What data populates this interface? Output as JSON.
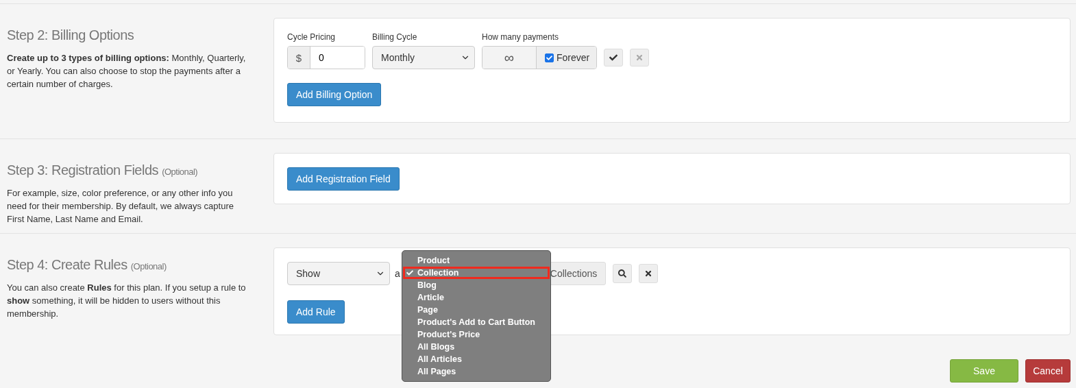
{
  "sections": [
    {
      "kind": "billing",
      "title": "Step 2: Billing Options",
      "description": "**Create up to 3 types of billing options:** Monthly, Quarterly, or Yearly. You can also choose to stop the payments after a certain number of charges.",
      "cycle_pricing": {
        "label": "Cycle Pricing",
        "prefix": "$",
        "value": "0"
      },
      "billing_cycle": {
        "label": "Billing Cycle",
        "value": "Monthly"
      },
      "payments": {
        "label": "How many payments",
        "symbol": "∞",
        "forever_label": "Forever",
        "forever_checked": true
      },
      "button": "Add Billing Option"
    },
    {
      "kind": "registration",
      "title": "Step 3: Registration Fields",
      "optional": "(Optional)",
      "description": "For example, size, color preference, or any other info you need for their membership. By default, we always capture First Name, Last Name and Email.",
      "button": "Add Registration Field"
    },
    {
      "kind": "rules",
      "title": "Step 4: Create Rules",
      "optional": "(Optional)",
      "description": "You can also create **Rules** for this plan. If you setup a rule to **show** something, it will be hidden to users without this membership.",
      "action": {
        "value": "Show"
      },
      "connector": "a",
      "target_button": "Collections",
      "button": "Add Rule",
      "dropdown": [
        {
          "label": "Product",
          "selected": false
        },
        {
          "label": "Collection",
          "selected": true
        },
        {
          "label": "Blog",
          "selected": false
        },
        {
          "label": "Article",
          "selected": false
        },
        {
          "label": "Page",
          "selected": false
        },
        {
          "label": "Product's Add to Cart Button",
          "selected": false
        },
        {
          "label": "Product's Price",
          "selected": false
        },
        {
          "label": "All Blogs",
          "selected": false
        },
        {
          "label": "All Articles",
          "selected": false
        },
        {
          "label": "All Pages",
          "selected": false
        }
      ]
    }
  ],
  "footer": {
    "save": "Save",
    "cancel": "Cancel"
  }
}
